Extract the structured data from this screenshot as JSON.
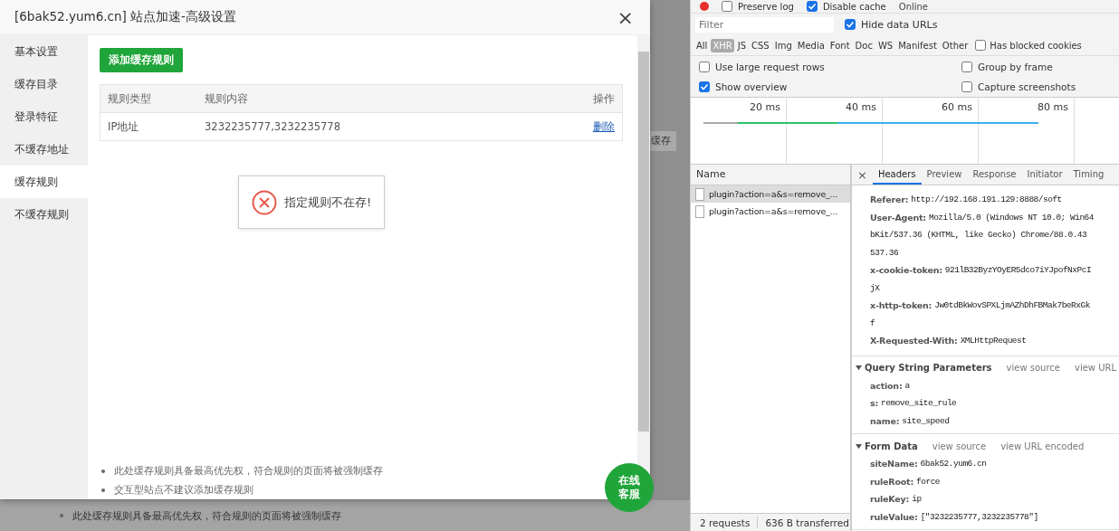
{
  "backdrop": {
    "tab_fragment": "缓存",
    "note": "此处缓存规则具备最高优先权，符合规则的页面将被强制缓存"
  },
  "modal": {
    "title": "[6bak52.yum6.cn] 站点加速-高级设置",
    "close": "×",
    "sidebar": [
      {
        "label": "基本设置",
        "selected": false
      },
      {
        "label": "缓存目录",
        "selected": false
      },
      {
        "label": "登录特征",
        "selected": false
      },
      {
        "label": "不缓存地址",
        "selected": false
      },
      {
        "label": "缓存规则",
        "selected": true
      },
      {
        "label": "不缓存规则",
        "selected": false
      }
    ],
    "add_button": "添加缓存规则",
    "table": {
      "columns": [
        "规则类型",
        "规则内容",
        "操作"
      ],
      "rows": [
        {
          "type": "IP地址",
          "content": "3232235777,3232235778",
          "action": "删除"
        }
      ]
    },
    "toast": {
      "message": "指定规则不在存!"
    },
    "notes": [
      "此处缓存规则具备最高优先权，符合规则的页面将被强制缓存",
      "交互型站点不建议添加缓存规则"
    ]
  },
  "chat_button": "在线客服",
  "devtools": {
    "toolbar": [
      {
        "label": "Preserve log",
        "checked": false
      },
      {
        "label": "Disable cache",
        "checked": true
      }
    ],
    "throttle": "Online",
    "filter": {
      "placeholder": "Filter"
    },
    "hide_data_urls": {
      "label": "Hide data URLs",
      "checked": true
    },
    "types": [
      {
        "label": "All",
        "selected": false
      },
      {
        "label": "XHR",
        "selected": true
      },
      {
        "label": "JS",
        "selected": false
      },
      {
        "label": "CSS",
        "selected": false
      },
      {
        "label": "Img",
        "selected": false
      },
      {
        "label": "Media",
        "selected": false
      },
      {
        "label": "Font",
        "selected": false
      },
      {
        "label": "Doc",
        "selected": false
      },
      {
        "label": "WS",
        "selected": false
      },
      {
        "label": "Manifest",
        "selected": false
      },
      {
        "label": "Other",
        "selected": false
      }
    ],
    "blocked_cookies": {
      "label": "Has blocked cookies",
      "checked": false
    },
    "options": [
      {
        "label": "Use large request rows",
        "checked": false
      },
      {
        "label": "Group by frame",
        "checked": false
      },
      {
        "label": "Show overview",
        "checked": true
      },
      {
        "label": "Capture screenshots",
        "checked": false
      }
    ],
    "overview": {
      "ticks": [
        "20 ms",
        "40 ms",
        "60 ms",
        "80 ms"
      ]
    },
    "name_header": "Name",
    "requests": [
      {
        "name": "plugin?action=a&s=remove_...",
        "selected": true
      },
      {
        "name": "plugin?action=a&s=remove_...",
        "selected": false
      }
    ],
    "status": [
      "2 requests",
      "636 B transferred"
    ],
    "close": "×",
    "detail_tabs": [
      {
        "label": "Headers",
        "selected": true
      },
      {
        "label": "Preview",
        "selected": false
      },
      {
        "label": "Response",
        "selected": false
      },
      {
        "label": "Initiator",
        "selected": false
      },
      {
        "label": "Timing",
        "selected": false
      }
    ],
    "request_headers": [
      {
        "key": "Referer:",
        "lines": [
          "http://192.168.191.129:8888/soft"
        ]
      },
      {
        "key": "User-Agent:",
        "lines": [
          "Mozilla/5.0 (Windows NT 10.0; Win64",
          "bKit/537.36 (KHTML, like Gecko) Chrome/88.0.43",
          "537.36"
        ]
      },
      {
        "key": "x-cookie-token:",
        "lines": [
          "921lB32ByzYOyER5dco7iYJpofNxPcI",
          "jX"
        ]
      },
      {
        "key": "x-http-token:",
        "lines": [
          "Jw0tdBkWovSPXLjmAZhDhFBMak7beRxGk",
          "f"
        ]
      },
      {
        "key": "X-Requested-With:",
        "lines": [
          "XMLHttpRequest"
        ]
      }
    ],
    "sections": [
      {
        "title": "Query String Parameters",
        "expanded": true,
        "links": [
          "view source",
          "view URL"
        ],
        "params": [
          {
            "key": "action:",
            "value": "a"
          },
          {
            "key": "s:",
            "value": "remove_site_rule"
          },
          {
            "key": "name:",
            "value": "site_speed"
          }
        ]
      },
      {
        "title": "Form Data",
        "expanded": true,
        "links": [
          "view source",
          "view URL encoded"
        ],
        "params": [
          {
            "key": "siteName:",
            "value": "6bak52.yum6.cn"
          },
          {
            "key": "ruleRoot:",
            "value": "force"
          },
          {
            "key": "ruleKey:",
            "value": "ip"
          },
          {
            "key": "ruleValue:",
            "value": "[\"3232235777,3232235778\"]"
          }
        ]
      }
    ]
  }
}
